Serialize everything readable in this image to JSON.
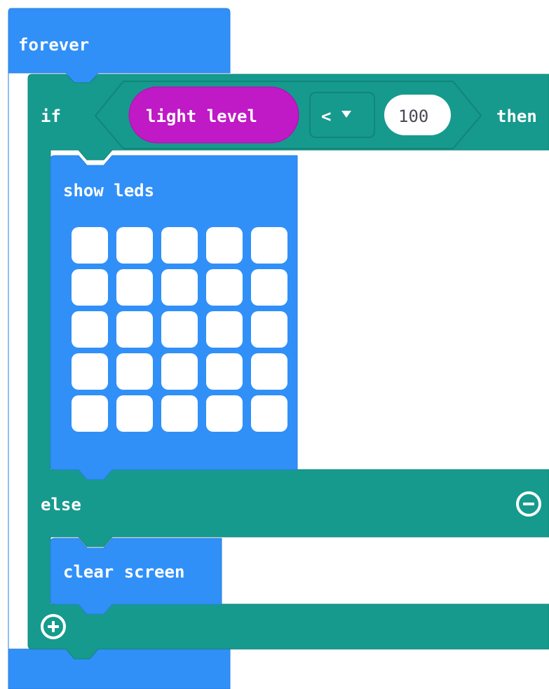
{
  "blocks": {
    "forever": {
      "label": "forever"
    },
    "if_else": {
      "if_label": "if",
      "then_label": "then",
      "else_label": "else"
    },
    "condition": {
      "left": "light level",
      "operator": "<",
      "right": "100"
    },
    "show_leds": {
      "label": "show leds",
      "leds": [
        [
          false,
          false,
          false,
          false,
          false
        ],
        [
          false,
          false,
          false,
          false,
          false
        ],
        [
          false,
          false,
          false,
          false,
          false
        ],
        [
          false,
          false,
          false,
          false,
          false
        ],
        [
          false,
          false,
          false,
          false,
          false
        ]
      ]
    },
    "clear_screen": {
      "label": "clear screen"
    }
  },
  "colors": {
    "basic_blue": "#3090f8",
    "logic_teal": "#169a8e",
    "input_magenta": "#c019c6"
  },
  "icons": {
    "dropdown": "triangle-down-icon",
    "remove_else": "minus-circle-icon",
    "add_branch": "plus-circle-icon"
  }
}
